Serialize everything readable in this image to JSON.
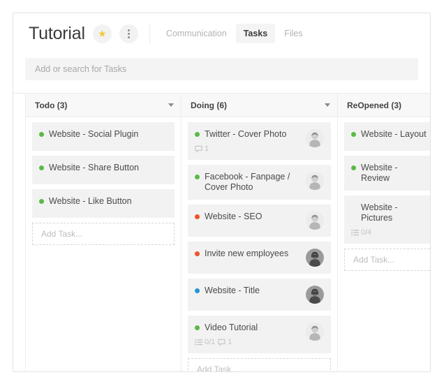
{
  "header": {
    "title": "Tutorial",
    "star_icon": "star-icon",
    "menu_icon": "more-vertical-icon",
    "tabs": [
      {
        "label": "Communication",
        "active": false
      },
      {
        "label": "Tasks",
        "active": true
      },
      {
        "label": "Files",
        "active": false
      }
    ]
  },
  "search": {
    "placeholder": "Add or search for Tasks",
    "value": ""
  },
  "board": {
    "add_task_label": "Add Task...",
    "columns": [
      {
        "title": "Todo (3)",
        "has_caret": true,
        "has_add_task": true,
        "tasks": [
          {
            "title": "Website - Social Plugin",
            "bullet": "green",
            "avatar": null,
            "checklist": null,
            "comments": null
          },
          {
            "title": "Website - Share Button",
            "bullet": "green",
            "avatar": null,
            "checklist": null,
            "comments": null
          },
          {
            "title": "Website - Like Button",
            "bullet": "green",
            "avatar": null,
            "checklist": null,
            "comments": null
          }
        ]
      },
      {
        "title": "Doing (6)",
        "has_caret": true,
        "has_add_task": true,
        "tasks": [
          {
            "title": "Twitter - Cover Photo",
            "bullet": "green",
            "avatar": "light",
            "checklist": null,
            "comments": "1"
          },
          {
            "title": "Facebook - Fanpage / Cover Photo",
            "bullet": "green",
            "avatar": "light",
            "checklist": null,
            "comments": null
          },
          {
            "title": "Website - SEO",
            "bullet": "red",
            "avatar": "light",
            "checklist": null,
            "comments": null
          },
          {
            "title": "Invite new employees",
            "bullet": "red",
            "avatar": "dark",
            "checklist": null,
            "comments": null
          },
          {
            "title": "Website - Title",
            "bullet": "blue",
            "avatar": "dark",
            "checklist": null,
            "comments": null
          },
          {
            "title": "Video Tutorial",
            "bullet": "green",
            "avatar": "light",
            "checklist": "0/1",
            "comments": "1"
          }
        ]
      },
      {
        "title": "ReOpened (3)",
        "has_caret": false,
        "has_add_task": true,
        "tasks": [
          {
            "title": "Website - Layout",
            "bullet": "green",
            "avatar": null,
            "checklist": null,
            "comments": null
          },
          {
            "title": "Website - Review",
            "bullet": "green",
            "avatar": null,
            "checklist": null,
            "comments": null
          },
          {
            "title": "Website - Pictures",
            "bullet": "none",
            "avatar": null,
            "checklist": "0/4",
            "comments": null,
            "indented": true
          }
        ]
      }
    ]
  }
}
